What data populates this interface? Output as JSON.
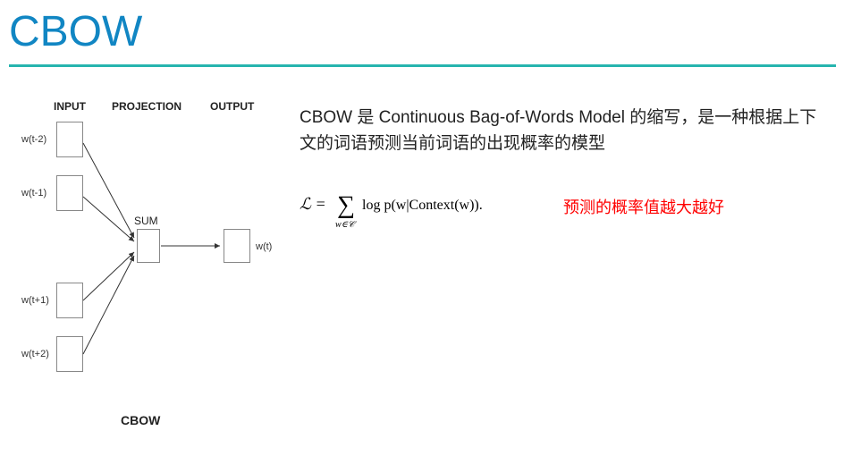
{
  "title": "CBOW",
  "diagram": {
    "col_input": "INPUT",
    "col_projection": "PROJECTION",
    "col_output": "OUTPUT",
    "label_wtm2": "w(t-2)",
    "label_wtm1": "w(t-1)",
    "label_wtp1": "w(t+1)",
    "label_wtp2": "w(t+2)",
    "label_sum": "SUM",
    "label_wt": "w(t)",
    "caption": "CBOW"
  },
  "description": "CBOW 是 Continuous Bag-of-Words Model 的缩写，是一种根据上下文的词语预测当前词语的出现概率的模型",
  "formula": {
    "lhs": "ℒ =",
    "sum": "∑",
    "subscript": "w∈𝒞",
    "rhs": "log p(w|Context(w)).",
    "display": "ℒ = ∑_{w∈C} log p(w|Context(w))"
  },
  "red_note": "预测的概率值越大越好"
}
